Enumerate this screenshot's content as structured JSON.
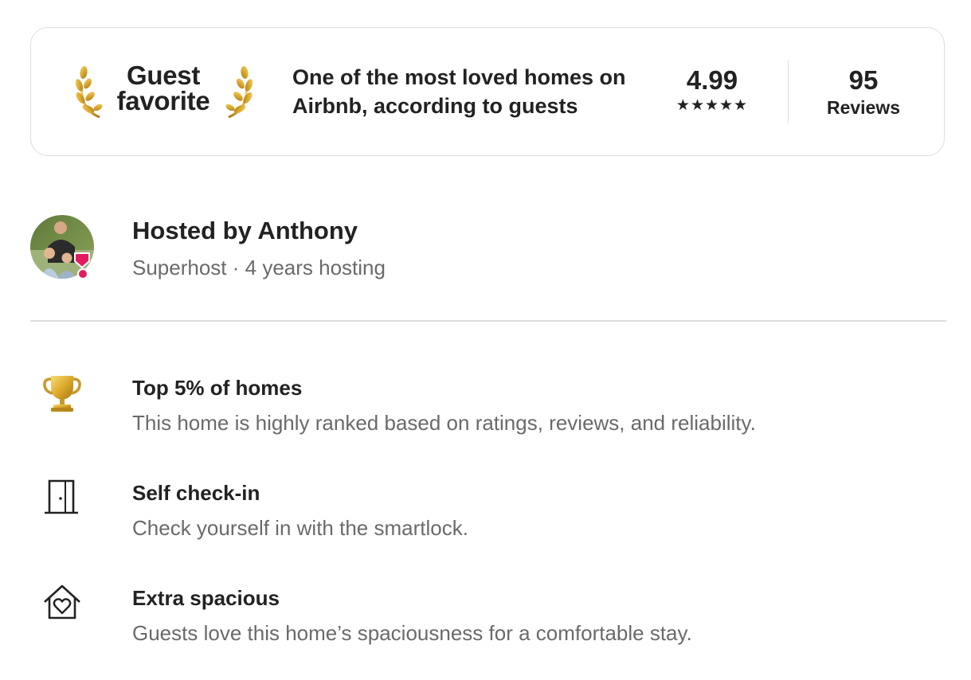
{
  "guest_favorite": {
    "label_line1": "Guest",
    "label_line2": "favorite",
    "description_line1": "One of the most loved homes on",
    "description_line2": "Airbnb, according to guests",
    "rating": "4.99",
    "stars": "★★★★★",
    "reviews_count": "95",
    "reviews_label": "Reviews",
    "laurel_icon": "laurel-icon",
    "laurel_color": "#d9a82e"
  },
  "host": {
    "name": "Hosted by Anthony",
    "meta": "Superhost · 4 years hosting",
    "avatar_icon": "avatar",
    "superhost_badge_icon": "superhost-badge-icon",
    "badge_color": "#e31c5f"
  },
  "highlights": [
    {
      "icon": "trophy-icon",
      "title": "Top 5% of homes",
      "subtitle": "This home is highly ranked based on ratings, reviews, and reliability."
    },
    {
      "icon": "door-icon",
      "title": "Self check-in",
      "subtitle": "Check yourself in with the smartlock."
    },
    {
      "icon": "house-heart-icon",
      "title": "Extra spacious",
      "subtitle": "Guests love this home’s spaciousness for a comfortable stay."
    }
  ],
  "colors": {
    "text_primary": "#222222",
    "text_secondary": "#6a6a6a",
    "border": "#dddddd",
    "gold": "#d9a82e"
  }
}
